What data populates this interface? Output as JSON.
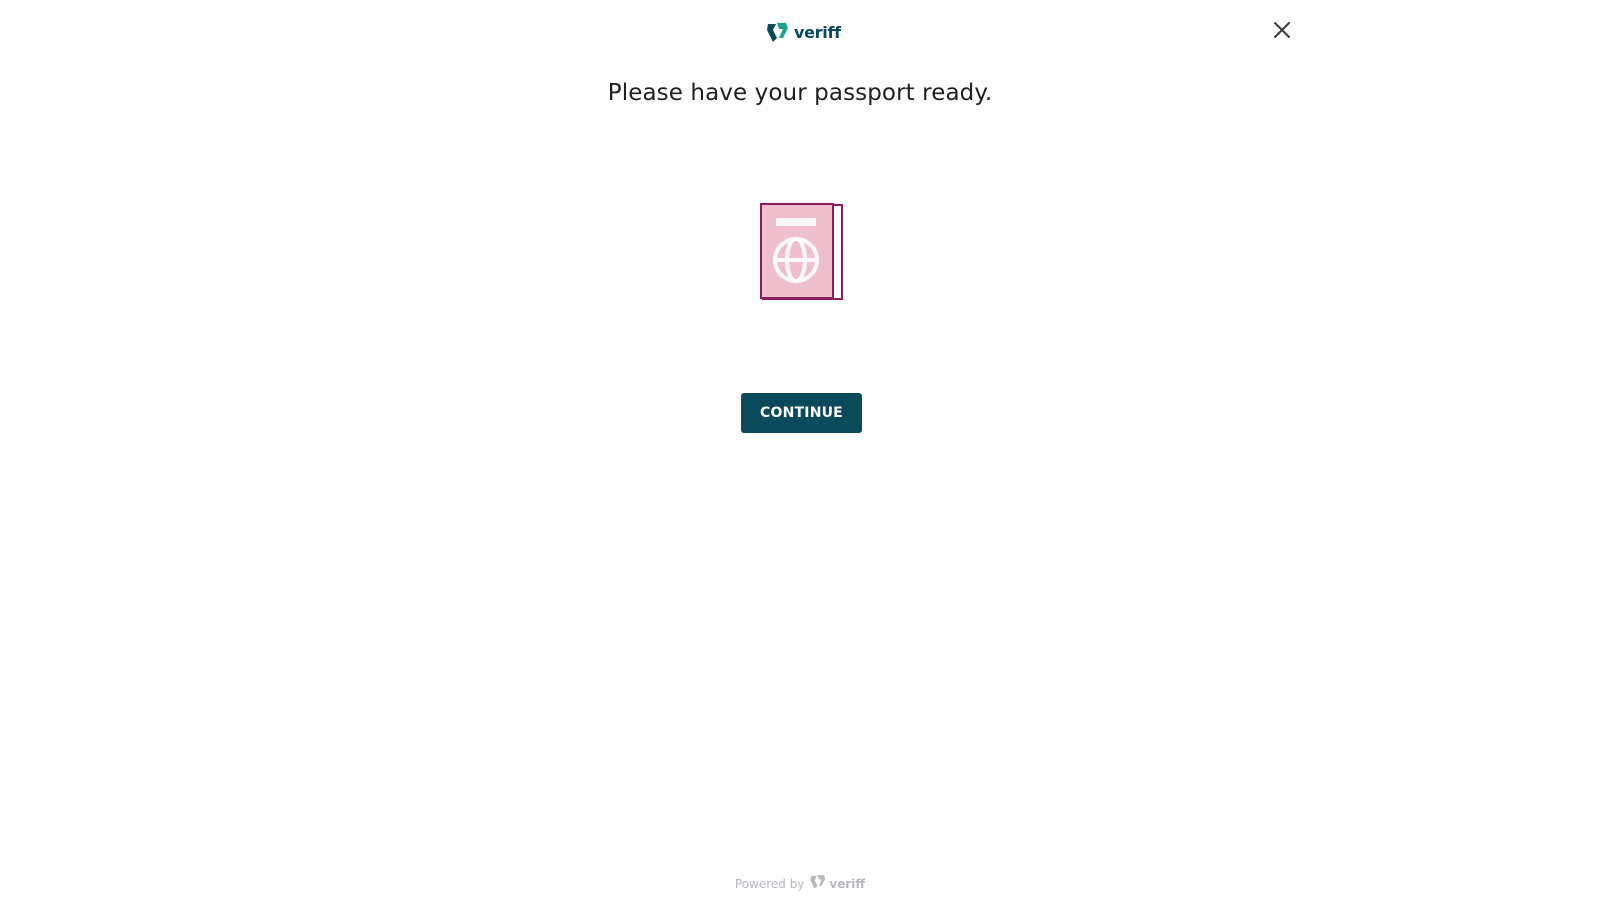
{
  "header": {
    "brand": "veriff",
    "logo_icon": "veriff-logo-icon",
    "close_icon": "close-icon"
  },
  "main": {
    "title": "Please have your passport ready.",
    "illustration_icon": "passport-icon",
    "continue_label": "CONTINUE"
  },
  "footer": {
    "powered_by": "Powered by",
    "brand": "veriff"
  },
  "colors": {
    "brand_primary": "#0a4a5a",
    "brand_accent": "#1aa391",
    "passport_fill": "#f0bfcd",
    "passport_stroke": "#8c1d5c",
    "footer_text": "#b8b8c0"
  }
}
